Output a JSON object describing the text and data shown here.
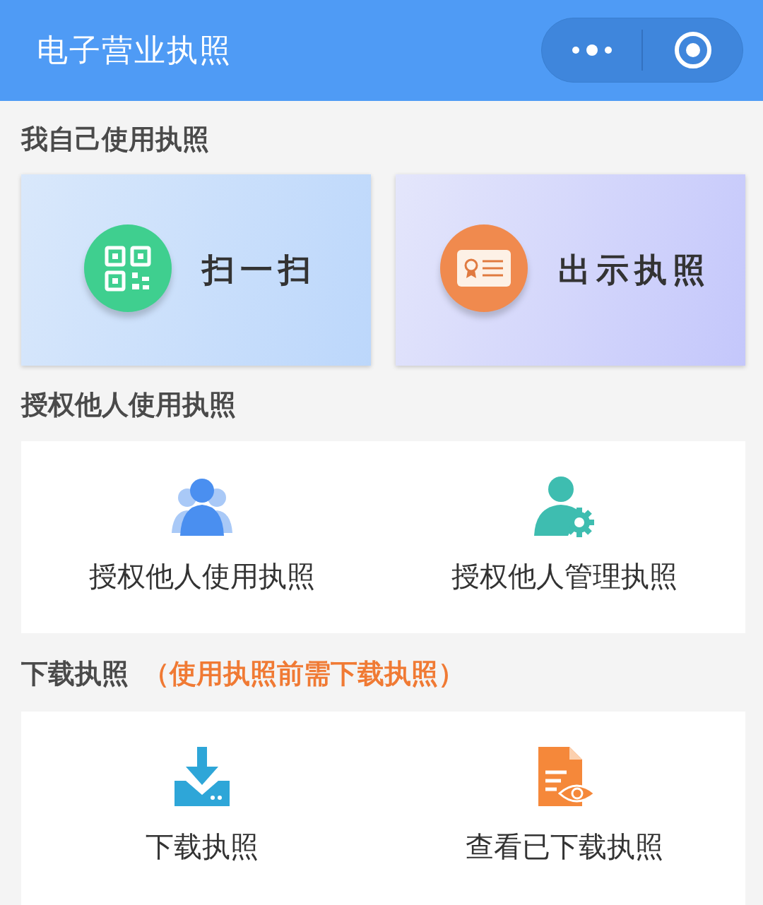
{
  "header": {
    "title": "电子营业执照"
  },
  "sections": [
    {
      "title": "我自己使用执照",
      "kind": "cards",
      "items": [
        {
          "label": "扫一扫",
          "kind": "qr"
        },
        {
          "label": "出示执照",
          "kind": "license"
        }
      ]
    },
    {
      "title": "授权他人使用执照",
      "kind": "panel",
      "items": [
        {
          "label": "授权他人使用执照",
          "kind": "people"
        },
        {
          "label": "授权他人管理执照",
          "kind": "person-gear"
        }
      ]
    },
    {
      "title": "下载执照",
      "note": "（使用执照前需下载执照）",
      "kind": "panel",
      "items": [
        {
          "label": "下载执照",
          "kind": "download"
        },
        {
          "label": "查看已下载执照",
          "kind": "document-eye"
        }
      ]
    }
  ]
}
